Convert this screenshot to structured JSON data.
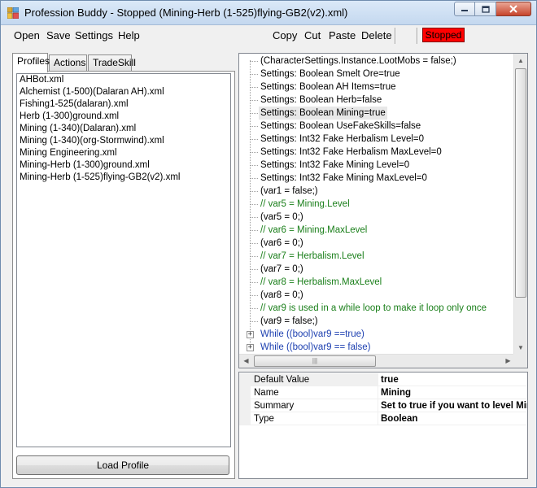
{
  "window": {
    "title": "Profession Buddy - Stopped (Mining-Herb (1-525)flying-GB2(v2).xml)"
  },
  "menu": {
    "items": [
      "Open",
      "Save",
      "Settings",
      "Help"
    ]
  },
  "toolbar": {
    "items": [
      "Copy",
      "Cut",
      "Paste",
      "Delete"
    ],
    "status": "Stopped",
    "status_color": "#ff0000"
  },
  "tabs": [
    "Profiles",
    "Actions",
    "TradeSkill"
  ],
  "active_tab": "Profiles",
  "profiles": [
    "AHBot.xml",
    "Alchemist (1-500)(Dalaran AH).xml",
    "Fishing1-525(dalaran).xml",
    "Herb (1-300)ground.xml",
    "Mining (1-340)(Dalaran).xml",
    "Mining (1-340)(org-Stormwind).xml",
    "Mining Engineering.xml",
    "Mining-Herb (1-300)ground.xml",
    "Mining-Herb (1-525)flying-GB2(v2).xml"
  ],
  "load_button": "Load Profile",
  "tree_items": [
    {
      "text": "(CharacterSettings.Instance.LootMobs = false;)",
      "kind": "normal"
    },
    {
      "text": "Settings: Boolean Smelt Ore=true",
      "kind": "normal"
    },
    {
      "text": "Settings: Boolean AH Items=true",
      "kind": "normal"
    },
    {
      "text": "Settings: Boolean Herb=false",
      "kind": "normal"
    },
    {
      "text": "Settings: Boolean Mining=true",
      "kind": "selected"
    },
    {
      "text": "Settings: Boolean UseFakeSkills=false",
      "kind": "normal"
    },
    {
      "text": "Settings: Int32 Fake Herbalism Level=0",
      "kind": "normal"
    },
    {
      "text": "Settings: Int32 Fake Herbalism MaxLevel=0",
      "kind": "normal"
    },
    {
      "text": "Settings: Int32 Fake Mining Level=0",
      "kind": "normal"
    },
    {
      "text": "Settings: Int32 Fake Mining MaxLevel=0",
      "kind": "normal"
    },
    {
      "text": "(var1 = false;)",
      "kind": "normal"
    },
    {
      "text": "// var5 = Mining.Level",
      "kind": "comment"
    },
    {
      "text": "(var5 = 0;)",
      "kind": "normal"
    },
    {
      "text": "// var6 = Mining.MaxLevel",
      "kind": "comment"
    },
    {
      "text": "(var6 = 0;)",
      "kind": "normal"
    },
    {
      "text": "// var7 = Herbalism.Level",
      "kind": "comment"
    },
    {
      "text": "(var7 = 0;)",
      "kind": "normal"
    },
    {
      "text": "// var8 = Herbalism.MaxLevel",
      "kind": "comment"
    },
    {
      "text": "(var8 = 0;)",
      "kind": "normal"
    },
    {
      "text": "// var9 is used in a while loop to make it loop only once",
      "kind": "comment"
    },
    {
      "text": "(var9 = false;)",
      "kind": "normal"
    },
    {
      "text": "While ((bool)var9 ==true)",
      "kind": "loop"
    },
    {
      "text": "While ((bool)var9 == false)",
      "kind": "loop"
    }
  ],
  "properties": [
    {
      "name": "Default Value",
      "value": "true"
    },
    {
      "name": "Name",
      "value": "Mining"
    },
    {
      "name": "Summary",
      "value": "Set to true if you want to level Mining"
    },
    {
      "name": "Type",
      "value": "Boolean"
    }
  ],
  "icons": {
    "app": "profession-buddy-app-icon",
    "minimize": "minimize-icon",
    "maximize": "maximize-icon",
    "close": "close-icon",
    "expand": "plus-expand-icon"
  }
}
